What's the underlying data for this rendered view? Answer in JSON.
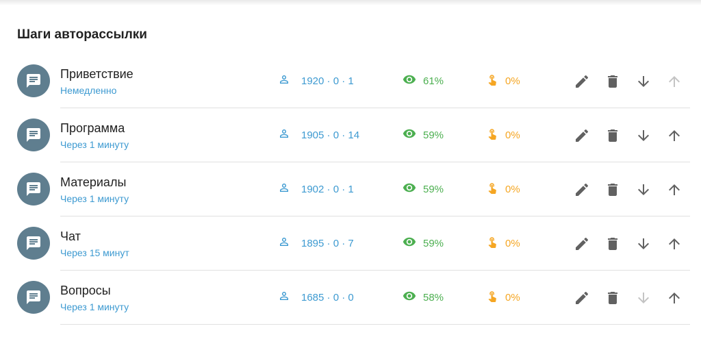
{
  "section": {
    "title": "Шаги авторассылки"
  },
  "colors": {
    "avatar": "#5f7e8f",
    "link": "#3d9ad1",
    "views": "#4caf50",
    "clicks": "#f5a623",
    "icon_active": "#616161",
    "icon_disabled": "#c4c4c4"
  },
  "steps": [
    {
      "title": "Приветствие",
      "delay": "Немедленно",
      "contacts": "1920 · 0 · 1",
      "views": "61%",
      "clicks": "0%",
      "can_move_down": true,
      "can_move_up": false
    },
    {
      "title": "Программа",
      "delay": "Через 1 минуту",
      "contacts": "1905 · 0 · 14",
      "views": "59%",
      "clicks": "0%",
      "can_move_down": true,
      "can_move_up": true
    },
    {
      "title": "Материалы",
      "delay": "Через 1 минуту",
      "contacts": "1902 · 0 · 1",
      "views": "59%",
      "clicks": "0%",
      "can_move_down": true,
      "can_move_up": true
    },
    {
      "title": "Чат",
      "delay": "Через 15 минут",
      "contacts": "1895 · 0 · 7",
      "views": "59%",
      "clicks": "0%",
      "can_move_down": true,
      "can_move_up": true
    },
    {
      "title": "Вопросы",
      "delay": "Через 1 минуту",
      "contacts": "1685 · 0 · 0",
      "views": "58%",
      "clicks": "0%",
      "can_move_down": false,
      "can_move_up": true
    }
  ]
}
